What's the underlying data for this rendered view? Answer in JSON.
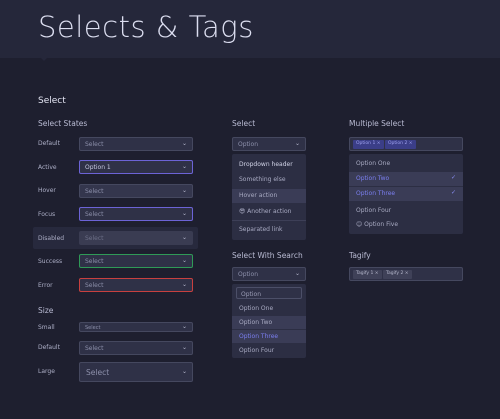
{
  "page": {
    "title": "Selects & Tags"
  },
  "sections": {
    "select": "Select"
  },
  "states": {
    "heading": "Select States",
    "items": [
      {
        "label": "Default",
        "value": "Select"
      },
      {
        "label": "Active",
        "value": "Option 1"
      },
      {
        "label": "Hover",
        "value": "Select"
      },
      {
        "label": "Focus",
        "value": "Select"
      },
      {
        "label": "Disabled",
        "value": "Select"
      },
      {
        "label": "Success",
        "value": "Select"
      },
      {
        "label": "Error",
        "value": "Select"
      }
    ]
  },
  "size": {
    "heading": "Size",
    "items": [
      {
        "label": "Small",
        "value": "Select"
      },
      {
        "label": "Default",
        "value": "Select"
      },
      {
        "label": "Large",
        "value": "Select"
      }
    ]
  },
  "select_demo": {
    "heading": "Select",
    "value": "Option",
    "menu": {
      "header": "Dropdown header",
      "items": [
        "Something else",
        "Hover action",
        "😎 Another action",
        "Separated link"
      ]
    }
  },
  "search_select": {
    "heading": "Select With Search",
    "value": "Option",
    "search_value": "Option",
    "options": [
      "Option One",
      "Option Two",
      "Option Three",
      "Option Four"
    ]
  },
  "multi_select": {
    "heading": "Multiple Select",
    "tags": [
      "Option 1 ×",
      "Option 2 ×"
    ],
    "options": [
      "Option One",
      "Option Two",
      "Option Three",
      "Option Four",
      "😊 Option Five"
    ],
    "check": "✓"
  },
  "tagify": {
    "heading": "Tagify",
    "tags": [
      "Tagify 1 ×",
      "Tagify 2 ×"
    ]
  },
  "icons": {
    "chevron": "⌄"
  }
}
